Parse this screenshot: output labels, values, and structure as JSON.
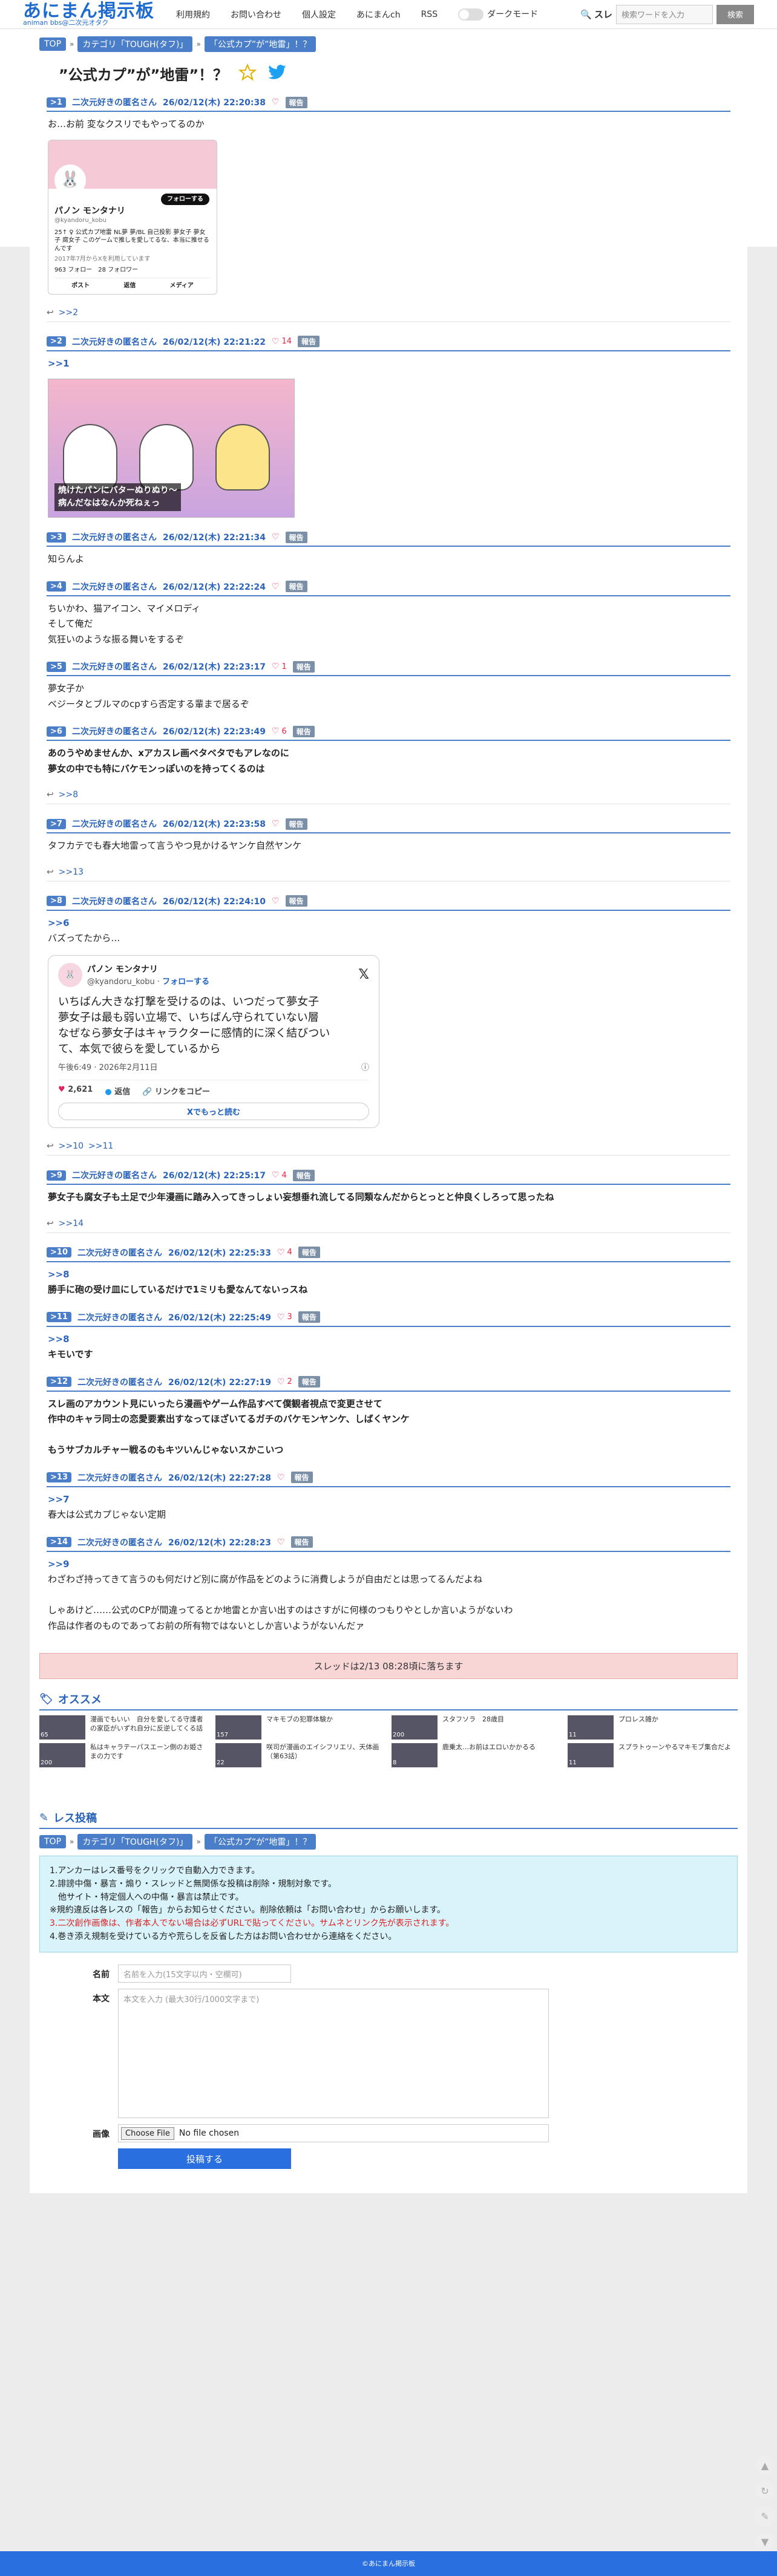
{
  "header": {
    "logo_title": "あにまん掲示板",
    "logo_sub": "animan bbs@二次元オタク",
    "nav": [
      "利用規約",
      "お問い合わせ",
      "個人設定",
      "あにまんch",
      "RSS"
    ],
    "dark_mode_label": "ダークモード",
    "search_select": "スレ",
    "search_placeholder": "検索ワードを入力",
    "search_button": "検索"
  },
  "breadcrumbs": [
    "TOP",
    "カテゴリ「TOUGH(タフ)」",
    "「公式カプ”が”地雷」！？"
  ],
  "thread": {
    "title": "”公式カプ”が”地雷”！？",
    "posts": [
      {
        "no": "1",
        "name": "二次元好きの匿名さん",
        "date": "26/02/12(木) 22:20:38",
        "likes": "",
        "body": "お…お前 変なクスリでもやってるのか",
        "bold": false
      },
      {
        "no": "2",
        "name": "二次元好きの匿名さん",
        "date": "26/02/12(木) 22:21:22",
        "likes": "14",
        "anchor": ">>1",
        "body": "",
        "bold": false
      },
      {
        "no": "3",
        "name": "二次元好きの匿名さん",
        "date": "26/02/12(木) 22:21:34",
        "likes": "",
        "body": "知らんよ",
        "bold": false
      },
      {
        "no": "4",
        "name": "二次元好きの匿名さん",
        "date": "26/02/12(木) 22:22:24",
        "likes": "",
        "body": "ちいかわ、猫アイコン、マイメロディ\nそして俺だ\n気狂いのような振る舞いをするぞ",
        "bold": false
      },
      {
        "no": "5",
        "name": "二次元好きの匿名さん",
        "date": "26/02/12(木) 22:23:17",
        "likes": "1",
        "body": "夢女子か\nベジータとブルマのcpすら否定する輩まで居るぞ",
        "bold": false
      },
      {
        "no": "6",
        "name": "二次元好きの匿名さん",
        "date": "26/02/12(木) 22:23:49",
        "likes": "6",
        "body": "あのうやめませんか、xアカスレ画ベタベタでもアレなのに\n夢女の中でも特にバケモンっぽいのを持ってくるのは",
        "bold": true
      },
      {
        "no": "7",
        "name": "二次元好きの匿名さん",
        "date": "26/02/12(木) 22:23:58",
        "likes": "",
        "body": "タフカテでも春大地雷って言うやつ見かけるヤンケ自然ヤンケ",
        "bold": false
      },
      {
        "no": "8",
        "name": "二次元好きの匿名さん",
        "date": "26/02/12(木) 22:24:10",
        "likes": "",
        "anchor": ">>6",
        "body": "バズってたから…",
        "bold": false
      },
      {
        "no": "9",
        "name": "二次元好きの匿名さん",
        "date": "26/02/12(木) 22:25:17",
        "likes": "4",
        "body": "夢女子も腐女子も土足で少年漫画に踏み入ってきっしょい妄想垂れ流してる同類なんだからとっとと仲良くしろって思ったね",
        "bold": true
      },
      {
        "no": "10",
        "name": "二次元好きの匿名さん",
        "date": "26/02/12(木) 22:25:33",
        "likes": "4",
        "anchor": ">>8",
        "body": "勝手に砲の受け皿にしているだけで1ミリも愛なんてないっスね",
        "bold": true
      },
      {
        "no": "11",
        "name": "二次元好きの匿名さん",
        "date": "26/02/12(木) 22:25:49",
        "likes": "3",
        "anchor": ">>8",
        "body": "キモいです",
        "bold": true
      },
      {
        "no": "12",
        "name": "二次元好きの匿名さん",
        "date": "26/02/12(木) 22:27:19",
        "likes": "2",
        "body": "スレ画のアカウント見にいったら漫画やゲーム作品すべて僕観者視点で変更させて\n作中のキャラ同士の恋愛要素出すなってほざいてるガチのバケモンヤンケ、しばくヤンケ\n\nもうサブカルチャー戦るのもキツいんじゃないスかこいつ",
        "bold": true
      },
      {
        "no": "13",
        "name": "二次元好きの匿名さん",
        "date": "26/02/12(木) 22:27:28",
        "likes": "",
        "anchor": ">>7",
        "body": "春大は公式カプじゃない定期",
        "bold": false
      },
      {
        "no": "14",
        "name": "二次元好きの匿名さん",
        "date": "26/02/12(木) 22:28:23",
        "likes": "",
        "anchor": ">>9",
        "body": "わざわざ持ってきて言うのも何だけど別に腐が作品をどのように消費しようが自由だとは思ってるんだよね\n\nしゃあけど……公式のCPが間違ってるとか地雷とか言い出すのはさすがに何様のつもりやとしか言いようがないわ\n作品は作者のものであってお前の所有物ではないとしか言いようがないんだァ",
        "bold": false
      }
    ],
    "replies_1": ">>2",
    "replies_6": ">>8",
    "replies_7": ">>13",
    "replies_8a": ">>10",
    "replies_8b": ">>11",
    "replies_9": ">>14"
  },
  "profile_card": {
    "name": "パノン モンタナリ",
    "handle": "@kyandoru_kobu",
    "follow": "フォローする",
    "bio": "25↑ ♀ 公式カプ地雷 NL夢 夢/BL 自己投影 夢女子 夢女子 腐女子 このゲームで推しを愛してるな、本当に推せるんです",
    "joined": "2017年7月からXを利用しています",
    "following": "963 フォロー",
    "followers": "28 フォロワー",
    "tabs": [
      "ポスト",
      "返信",
      "メディア"
    ]
  },
  "image_caption": "焼けたパンにバターぬりぬり〜\n病んだなはなんか死ねぇっ",
  "tweet": {
    "name": "パノン モンタナリ",
    "handle": "@kyandoru_kobu",
    "follow": "フォローする",
    "text": "いちばん大きな打撃を受けるのは、いつだって夢女子\n夢女子は最も弱い立場で、いちばん守られていない層\nなぜなら夢女子はキャラクターに感情的に深く結びつい\nて、本気で彼らを愛しているから",
    "time": "午後6:49 · 2026年2月11日",
    "likes": "2,621",
    "reply": "返信",
    "copy": "リンクをコピー",
    "more": "Xでもっと読む"
  },
  "limit_notice": "スレッドは2/13 08:28頃に落ちます",
  "recommend": {
    "title": "オススメ",
    "items": [
      {
        "title": "漫画でもいい　自分を愛してる守護者の家臣がいずれ自分に反逆してくる話",
        "count": "65"
      },
      {
        "title": "マキモブの犯罪体験か",
        "count": "157"
      },
      {
        "title": "スタフソラ　28歳目",
        "count": "200"
      },
      {
        "title": "プロレス雑か",
        "count": "11"
      },
      {
        "title": "私はキャラテーパスエーン側のお姫さまの力です",
        "count": "200"
      },
      {
        "title": "咲司が漫画のエイシフリエリ、天体画（第63話）",
        "count": "22"
      },
      {
        "title": "鹿乗太…お前はエロいかかるる",
        "count": "8"
      },
      {
        "title": "スプラトゥーンやるマキモブ集合だよ",
        "count": "11"
      }
    ]
  },
  "reply_form": {
    "title": "レス投稿",
    "notes": [
      "1.アンカーはレス番号をクリックで自動入力できます。",
      "2.誹謗中傷・暴言・煽り・スレッドと無関係な投稿は削除・規制対象です。",
      "　他サイト・特定個人への中傷・暴言は禁止です。",
      "※規約違反は各レスの「報告」からお知らせください。削除依頼は「お問い合わせ」からお願いします。",
      "3.二次創作画像は、作者本人でない場合は必ずURLで貼ってください。サムネとリンク先が表示されます。",
      "4.巻き添え規制を受けている方や荒らしを反省した方はお問い合わせから連絡をください。"
    ],
    "name_label": "名前",
    "name_placeholder": "名前を入力(15文字以内・空欄可)",
    "body_label": "本文",
    "body_placeholder": "本文を入力 (最大30行/1000文字まで)",
    "image_label": "画像",
    "file_button": "Choose File",
    "file_status": "No file chosen",
    "submit": "投稿する"
  },
  "footer": "©あにまん掲示板",
  "colors": {
    "accent": "#4a7ec8",
    "link": "#2a63b8",
    "heart": "#e24444",
    "footer": "#2a6fe0"
  }
}
